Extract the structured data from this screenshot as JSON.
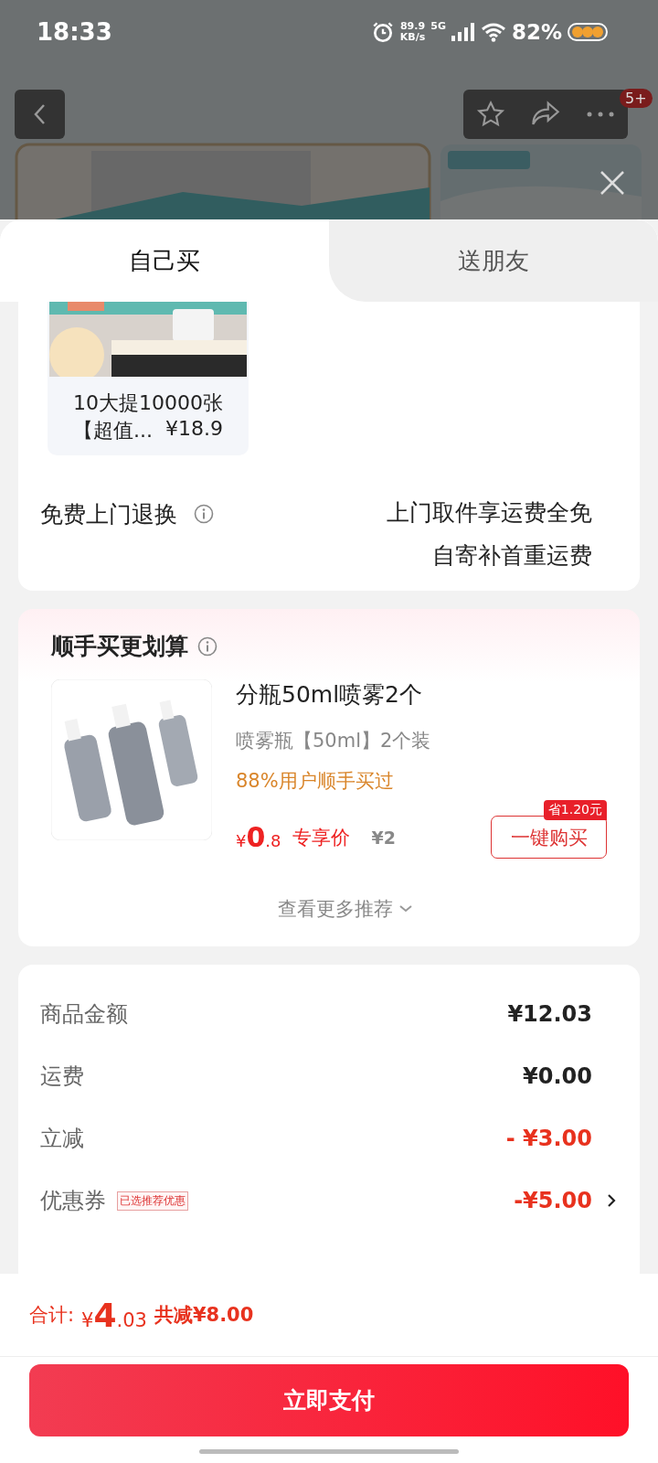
{
  "status_bar": {
    "time": "18:33",
    "speed_value": "89.9",
    "speed_unit": "KB/s",
    "network": "5G",
    "battery": "82%"
  },
  "header": {
    "badge": "5+"
  },
  "tabs": [
    {
      "label": "自己买",
      "selected": true
    },
    {
      "label": "送朋友",
      "selected": false
    }
  ],
  "product": {
    "kind": "picture",
    "name_line1": "10大提10000张",
    "name_line2": "【超值...",
    "price": "¥18.9"
  },
  "returns": {
    "title": "免费上门退换",
    "notes": [
      "上门取件享运费全免",
      "自寄补首重运费"
    ]
  },
  "addon": {
    "title": "顺手买更划算",
    "item": {
      "name": "分瓶50ml喷雾2个",
      "spec": "喷雾瓶【50ml】2个装",
      "social": "88%用户顺手买过",
      "currency": "¥",
      "price_int": "0",
      "price_dec": ".8",
      "price_tag": "专享价",
      "original_price": "¥2",
      "save_badge": "省1.20元",
      "buy_button": "一键购买"
    },
    "more": "查看更多推荐"
  },
  "summary": [
    {
      "kind": "plain",
      "label": "商品金额",
      "value": "¥12.03"
    },
    {
      "kind": "plain",
      "label": "运费",
      "value": "¥0.00"
    },
    {
      "kind": "discount",
      "label": "立减",
      "value": "- ¥3.00"
    },
    {
      "kind": "coupon",
      "label": "优惠券",
      "tag": "已选推荐优惠",
      "value": "-¥5.00"
    }
  ],
  "footer": {
    "total_label": "合计:",
    "currency": "¥",
    "total_int": "4",
    "total_dec": ".03",
    "saved": "共减¥8.00",
    "pay_button": "立即支付"
  }
}
